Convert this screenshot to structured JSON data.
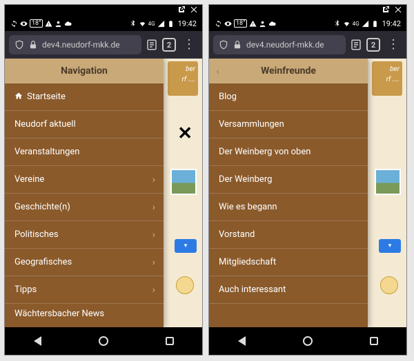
{
  "status": {
    "time": "19:42",
    "temp": "18°",
    "net_label": "4G"
  },
  "browser": {
    "url": "dev4.neudorf-mkk.de",
    "tab_count": "2"
  },
  "left_drawer": {
    "title": "Navigation",
    "items": [
      {
        "label": "Startseite",
        "home": true,
        "sub": false
      },
      {
        "label": "Neudorf aktuell",
        "sub": false
      },
      {
        "label": "Veranstaltungen",
        "sub": false
      },
      {
        "label": "Vereine",
        "sub": true
      },
      {
        "label": "Geschichte(n)",
        "sub": true
      },
      {
        "label": "Politisches",
        "sub": true
      },
      {
        "label": "Geografisches",
        "sub": true
      },
      {
        "label": "Tipps",
        "sub": true
      },
      {
        "label": "Wächtersbacher News",
        "sub": false,
        "cut": true
      }
    ]
  },
  "right_drawer": {
    "title": "Weinfreunde",
    "items": [
      {
        "label": "Blog"
      },
      {
        "label": "Versammlungen"
      },
      {
        "label": "Der Weinberg von oben"
      },
      {
        "label": "Der Weinberg"
      },
      {
        "label": "Wie es begann"
      },
      {
        "label": "Vorstand"
      },
      {
        "label": "Mitgliedschaft"
      },
      {
        "label": "Auch interessant"
      }
    ]
  },
  "bg": {
    "banner_line1": "ber",
    "banner_line2": "rf ....",
    "close": "✕",
    "chip": "▾"
  }
}
